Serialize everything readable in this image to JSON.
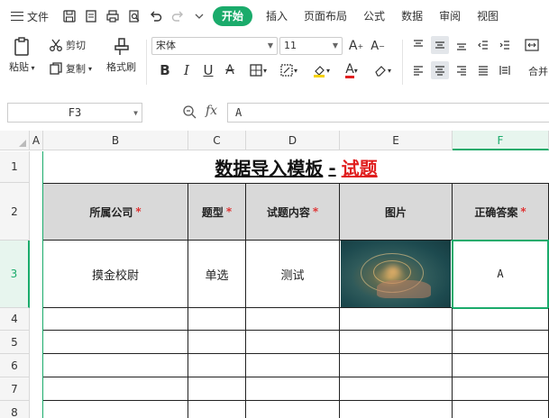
{
  "menubar": {
    "file_label": "文件",
    "tabs": [
      {
        "label": "开始"
      },
      {
        "label": "插入"
      },
      {
        "label": "页面布局"
      },
      {
        "label": "公式"
      },
      {
        "label": "数据"
      },
      {
        "label": "审阅"
      },
      {
        "label": "视图"
      }
    ]
  },
  "toolbar": {
    "paste_label": "粘贴",
    "cut_label": "剪切",
    "copy_label": "复制",
    "format_painter_label": "格式刷",
    "font_name": "宋体",
    "font_size": "11",
    "merge_label": "合并"
  },
  "formula_bar": {
    "name_box": "F3",
    "fx_label": "fx",
    "formula_value": "A"
  },
  "sheet": {
    "columns": [
      "A",
      "B",
      "C",
      "D",
      "E",
      "F"
    ],
    "rows": [
      "1",
      "2",
      "3",
      "4",
      "5",
      "6",
      "7",
      "8"
    ],
    "title": {
      "main": "数据导入模板",
      "sep": "-",
      "sub": "试题"
    },
    "headers": [
      {
        "label": "所属公司",
        "required": "*"
      },
      {
        "label": "题型",
        "required": "*"
      },
      {
        "label": "试题内容",
        "required": "*"
      },
      {
        "label": "图片",
        "required": ""
      },
      {
        "label": "正确答案",
        "required": "*"
      }
    ],
    "row3": {
      "company": "摸金校尉",
      "type": "单选",
      "content": "测试",
      "answer": "A"
    },
    "selected_cell": "F3"
  },
  "colors": {
    "accent": "#1aab6b",
    "required": "#e01e1e",
    "header_fill": "#d9d9d9"
  }
}
